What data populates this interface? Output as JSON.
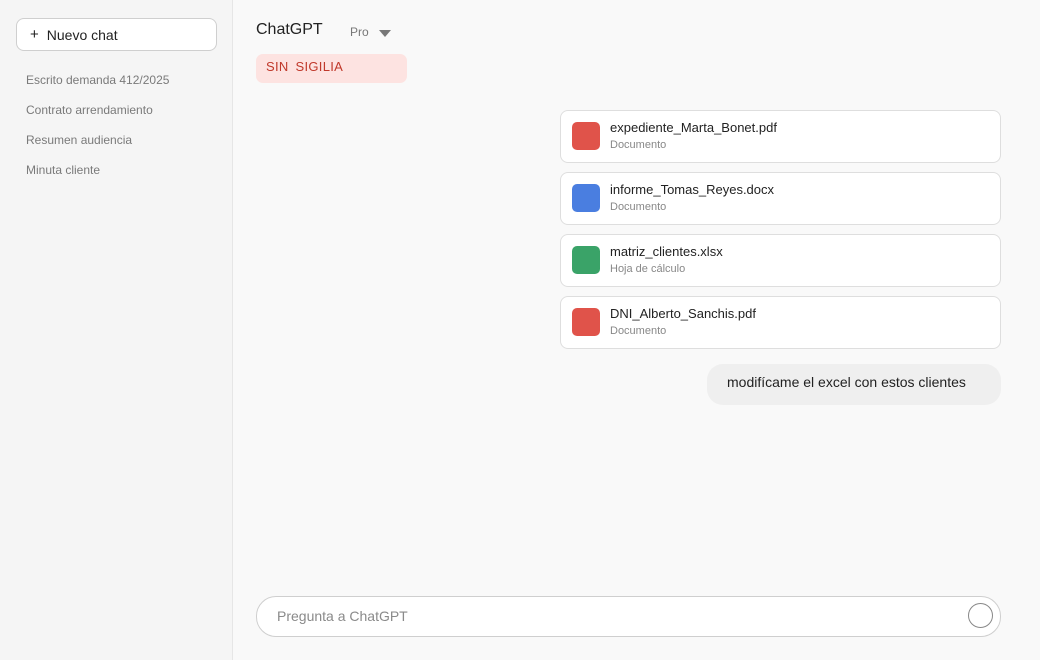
{
  "sidebar": {
    "new_chat_label": "Nuevo chat",
    "new_chat_icon": "+",
    "history": [
      {
        "label": "Escrito demanda 412/2025"
      },
      {
        "label": "Contrato arrendamiento"
      },
      {
        "label": "Resumen audiencia"
      },
      {
        "label": "Minuta cliente"
      }
    ]
  },
  "header": {
    "model_name": "ChatGPT",
    "model_tier": "Pro",
    "dropdown_icon": "chevron-down-icon",
    "warning_badge": "SIN SIGILIA",
    "warning_color": "#c0392b"
  },
  "attachments": [
    {
      "name": "expediente_Marta_Bonet.pdf",
      "type": "Documento",
      "color": "#e0534a"
    },
    {
      "name": "informe_Tomas_Reyes.docx",
      "type": "Documento",
      "color": "#4a7ee0"
    },
    {
      "name": "matriz_clientes.xlsx",
      "type": "Hoja de cálculo",
      "color": "#3aa368"
    },
    {
      "name": "DNI_Alberto_Sanchis.pdf",
      "type": "Documento",
      "color": "#e0534a"
    }
  ],
  "message": {
    "text": "modifícame el excel con estos clientes"
  },
  "composer": {
    "placeholder": "Pregunta a ChatGPT",
    "value": "",
    "send_icon": "send-icon"
  }
}
